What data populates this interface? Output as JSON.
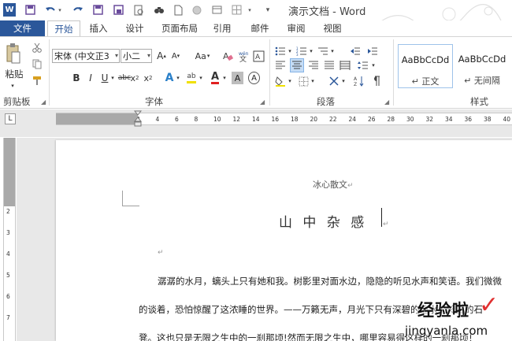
{
  "window": {
    "title": "演示文档 - Word",
    "app_icon_letter": "W"
  },
  "quick_access": [
    "save-icon",
    "open-icon",
    "undo-icon",
    "redo-icon",
    "save-as-icon",
    "print-preview-icon",
    "find-icon",
    "new-icon",
    "record-icon",
    "table-icon",
    "more-icon"
  ],
  "tabs": [
    "文件",
    "开始",
    "插入",
    "设计",
    "页面布局",
    "引用",
    "邮件",
    "审阅",
    "视图"
  ],
  "active_tab": "开始",
  "ribbon": {
    "clipboard": {
      "paste_label": "粘贴",
      "group_label": "剪贴板"
    },
    "font": {
      "font_name": "宋体 (中文正3",
      "font_size": "小二",
      "grow": "A",
      "shrink": "A",
      "case": "Aa",
      "bold": "B",
      "italic": "I",
      "underline": "U",
      "strike": "abc",
      "subscript": "x",
      "superscript": "x",
      "sub_mark": "2",
      "sup_mark": "2",
      "text_effect": "A",
      "highlight": "ab",
      "font_color": "A",
      "char_shading": "A",
      "char_border": "A",
      "group_label": "字体"
    },
    "paragraph": {
      "group_label": "段落"
    },
    "styles": {
      "items": [
        {
          "sample": "AaBbCcDd",
          "name": "↵ 正文"
        },
        {
          "sample": "AaBbCcDd",
          "name": "↵ 无间隔"
        }
      ],
      "group_label": "样式"
    }
  },
  "ruler": {
    "corner": "L",
    "h_ticks": [
      "8",
      "6",
      "4",
      "2",
      "2",
      "4",
      "6",
      "8",
      "10",
      "12",
      "14",
      "16",
      "18",
      "20",
      "22",
      "24",
      "26",
      "28",
      "30",
      "32",
      "34",
      "36",
      "38",
      "40",
      "42",
      "44",
      "46"
    ],
    "v_ticks": [
      "2",
      "1",
      "1",
      "2",
      "3",
      "4",
      "5",
      "6",
      "7",
      "8"
    ]
  },
  "document": {
    "subtitle": "冰心散文",
    "title": "山 中 杂 感",
    "line1": "潺潺的水月，螭头上只有她和我。树影里对面水边，隐隐的听见水声和笑语。我们微微",
    "line2": "的谈着，恐怕惊醒了这浓睡的世界。——万籁无声，月光下只有深碧的池水，玲白的石",
    "line3": "凳。这也只是无限之生中的一刹那顷!然而无限之生中，哪里容易得这样的一刹那顷！",
    "para_mark": "↵"
  },
  "watermark": {
    "text": "经验啦",
    "domain": "jingyanla.com",
    "check": "✓"
  },
  "colors": {
    "accent": "#2b579a",
    "ruler_margin": "#a9a9a9",
    "watermark": "#e03030"
  }
}
